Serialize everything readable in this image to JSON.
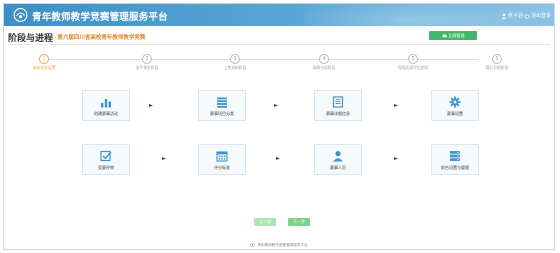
{
  "header": {
    "app_title": "青年教师教学竞赛管理服务平台",
    "user_name": "张子涵",
    "logout_label": "退出登录",
    "colors": {
      "bar": "#4c9ccf",
      "accent": "#f0a44c",
      "green": "#3fb86b"
    }
  },
  "page": {
    "title": "阶段与进程",
    "subtitle": "- 第六届四川省高校青年教师教学竞赛",
    "manage_button": "比赛管理"
  },
  "steps": [
    {
      "num": "1",
      "label": "基础信息设置",
      "active": true
    },
    {
      "num": "2",
      "label": "选手报名阶段",
      "active": false
    },
    {
      "num": "3",
      "label": "上传材料阶段",
      "active": false
    },
    {
      "num": "4",
      "label": "网络分组阶段",
      "active": false
    },
    {
      "num": "5",
      "label": "现场比赛评比阶段",
      "active": false
    },
    {
      "num": "6",
      "label": "赛后总结阶段",
      "active": false
    }
  ],
  "tiles": [
    {
      "label": "创建赛事活动",
      "icon": "bar-chart-icon"
    },
    {
      "label": "赛事项目分类",
      "icon": "list-icon"
    },
    {
      "label": "赛事详细信息",
      "icon": "document-icon"
    },
    {
      "label": "赛事设置",
      "icon": "gear-icon"
    },
    {
      "label": "竞赛评审",
      "icon": "checkbox-icon"
    },
    {
      "label": "评分标准",
      "icon": "calendar-icon"
    },
    {
      "label": "赛事人员",
      "icon": "person-icon"
    },
    {
      "label": "前台设置与管理",
      "icon": "server-icon"
    }
  ],
  "nav": {
    "prev_label": "上一步",
    "next_label": "下一步"
  },
  "footer": {
    "text": "青年教师教学竞赛管理服务平台"
  }
}
